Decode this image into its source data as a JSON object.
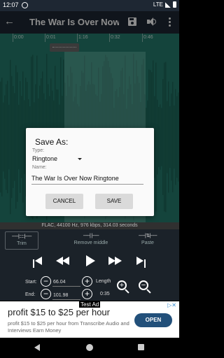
{
  "status_bar": {
    "time": "12:07",
    "network": "LTE"
  },
  "app_bar": {
    "back_icon": "arrow-left-icon",
    "title": "The War Is Over Now -...",
    "save_icon": "save-icon",
    "volume_icon": "volume-icon",
    "more_icon": "more-vert-icon"
  },
  "timeline": {
    "ticks": [
      "0:00",
      "0:01",
      "1:16",
      "0:32",
      "0:46"
    ]
  },
  "dialog": {
    "title": "Save As:",
    "type_label": "Type:",
    "type_value": "Ringtone",
    "name_label": "Name:",
    "name_value": "The War Is Over Now Ringtone",
    "cancel_label": "CANCEL",
    "save_label": "SAVE"
  },
  "info": {
    "text": "FLAC, 44100 Hz, 976 kbps, 314.03 seconds"
  },
  "edit_tabs": {
    "trim": {
      "glyph": "-----|:::::|-----",
      "label": "Trim"
    },
    "remove_middle": {
      "glyph": "-----|    |-----",
      "label": "Remove middle"
    },
    "paste": {
      "glyph": "-----|⇅|-----",
      "label": "Paste"
    }
  },
  "playback": {
    "icons": [
      "skip-start-icon",
      "rewind-icon",
      "play-icon",
      "fast-forward-icon",
      "skip-end-icon"
    ]
  },
  "fields": {
    "start_label": "Start:",
    "start_value": "66.04",
    "end_label": "End:",
    "end_value": "101.98",
    "length_label": "Length",
    "length_value": "0:35",
    "minus": "−",
    "plus": "+"
  },
  "zoom": {
    "in": "+",
    "out": "−"
  },
  "ad": {
    "label": "Test Ad",
    "title": "profit $15 to $25 per hour",
    "text": "profit $15 to $25 per hour from Transcribe Audio and Interviews Earn Money",
    "button": "OPEN",
    "choice": "▷✕"
  }
}
